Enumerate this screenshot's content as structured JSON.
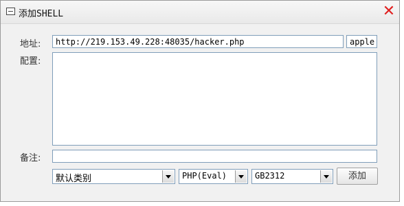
{
  "dialog": {
    "title": "添加SHELL",
    "close_label": "✕"
  },
  "form": {
    "address_label": "地址:",
    "address_value": "http://219.153.49.228:48035/hacker.php",
    "password_value": "apple",
    "config_label": "配置:",
    "config_value": "",
    "note_label": "备注:",
    "note_value": ""
  },
  "selects": {
    "category": "默认类别",
    "script_type": "PHP(Eval)",
    "encoding": "GB2312"
  },
  "buttons": {
    "add_label": "添加"
  }
}
